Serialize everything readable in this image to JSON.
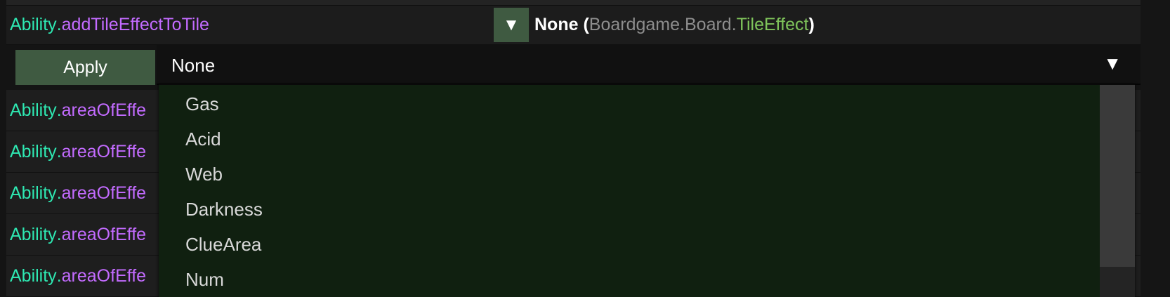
{
  "header_row": {
    "class_name": "Ability",
    "dot": ".",
    "member": "addTileEffectToTile",
    "dropdown_icon": "triangle-down-icon",
    "value": "None",
    "type_open": " (",
    "type_ns1": "Boardgame",
    "type_dot1": ".",
    "type_ns2": "Board",
    "type_dot2": ".",
    "type_name": "TileEffect",
    "type_close": ")"
  },
  "editor": {
    "apply_label": "Apply",
    "selected_value": "None",
    "arrow_icon": "triangle-down-icon"
  },
  "options": [
    "Gas",
    "Acid",
    "Web",
    "Darkness",
    "ClueArea",
    "Num"
  ],
  "rows": [
    {
      "class_name": "Ability",
      "dot": ".",
      "member": "areaOfEffe"
    },
    {
      "class_name": "Ability",
      "dot": ".",
      "member": "areaOfEffe"
    },
    {
      "class_name": "Ability",
      "dot": ".",
      "member": "areaOfEffe"
    },
    {
      "class_name": "Ability",
      "dot": ".",
      "member": "areaOfEffe"
    },
    {
      "class_name": "Ability",
      "dot": ".",
      "member": "areaOfEffe"
    }
  ],
  "colors": {
    "class_color": "#2ee8b2",
    "member_color": "#c36bff",
    "type_color": "#7fc45b",
    "namespace_color": "#8d8d8d",
    "button_bg": "#3f5a41",
    "popup_bg": "#102010"
  }
}
